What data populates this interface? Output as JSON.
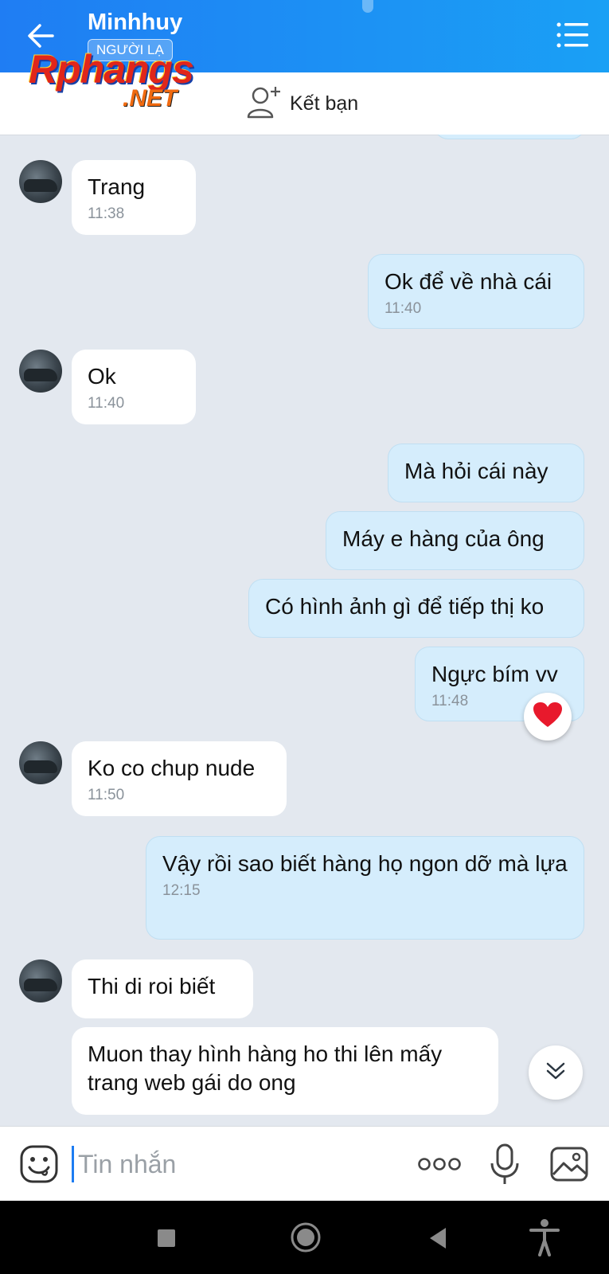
{
  "header": {
    "contact_name": "Minhhuy",
    "stranger_badge": "NGƯỜI LẠ",
    "add_friend_label": "Kết bạn"
  },
  "watermark": {
    "main": "Rphangs",
    "suffix": ".NET"
  },
  "messages": [
    {
      "dir": "in",
      "text": "Trang",
      "time": "11:38"
    },
    {
      "dir": "out",
      "text": "Ok để về nhà cái",
      "time": "11:40"
    },
    {
      "dir": "in",
      "text": "Ok",
      "time": "11:40"
    },
    {
      "dir": "out",
      "text": "Mà hỏi cái này",
      "time": ""
    },
    {
      "dir": "out",
      "text": "Máy e hàng của ông",
      "time": ""
    },
    {
      "dir": "out",
      "text": "Có hình ảnh gì để tiếp thị ko",
      "time": ""
    },
    {
      "dir": "out",
      "text": "Ngực bím vv",
      "time": "11:48"
    },
    {
      "dir": "in",
      "text": "Ko co chup nude",
      "time": "11:50"
    },
    {
      "dir": "out",
      "text": "Vậy rồi sao biết hàng họ ngon dỡ mà lựa",
      "time": "12:15"
    },
    {
      "dir": "in",
      "text": "Thi di roi biết",
      "time": ""
    },
    {
      "dir": "in",
      "text": "Muon thay hình hàng ho thi lên mấy trang web gái do ong",
      "time": ""
    }
  ],
  "reaction": {
    "icon": "heart-icon",
    "color": "#e8192c"
  },
  "input": {
    "placeholder": "Tin nhắn"
  },
  "colors": {
    "header": "#1f7df3",
    "outgoing_bubble": "#d5edfc",
    "incoming_bubble": "#ffffff",
    "background": "#e3e8ef"
  }
}
